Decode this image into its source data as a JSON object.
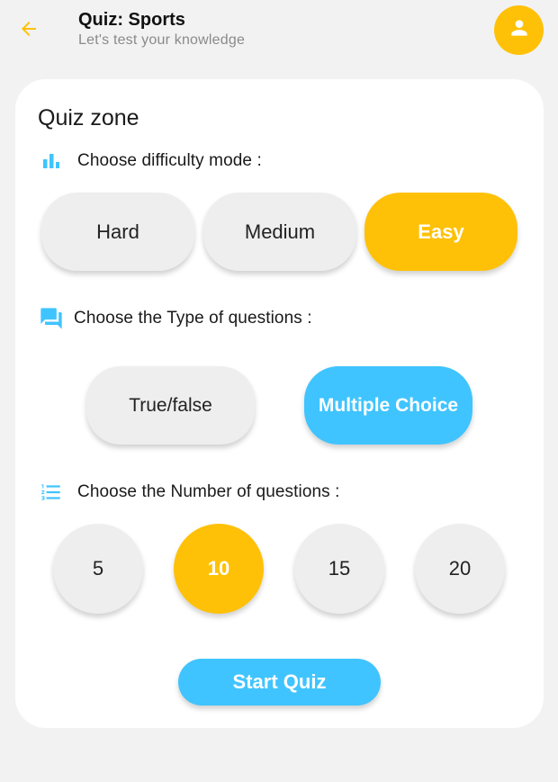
{
  "header": {
    "title": "Quiz: Sports",
    "subtitle": "Let's test your knowledge",
    "back_icon": "arrow-left-icon",
    "avatar_icon": "person-icon"
  },
  "colors": {
    "accent_yellow": "#ffc107",
    "accent_blue": "#40c4ff",
    "unselected": "#eeeeee",
    "background": "#f2f2f2",
    "card": "#ffffff"
  },
  "quiz": {
    "title": "Quiz zone",
    "difficulty": {
      "label": "Choose difficulty mode :",
      "icon": "bar-chart-icon",
      "options": [
        "Hard",
        "Medium",
        "Easy"
      ],
      "selected": "Easy"
    },
    "question_type": {
      "label": "Choose the Type of questions :",
      "icon": "chat-bubbles-icon",
      "options": [
        "True/false",
        "Multiple Choice"
      ],
      "selected": "Multiple Choice"
    },
    "question_count": {
      "label": "Choose the Number of questions :",
      "icon": "numbered-list-icon",
      "options": [
        "5",
        "10",
        "15",
        "20"
      ],
      "selected": "10"
    },
    "start_label": "Start Quiz"
  }
}
